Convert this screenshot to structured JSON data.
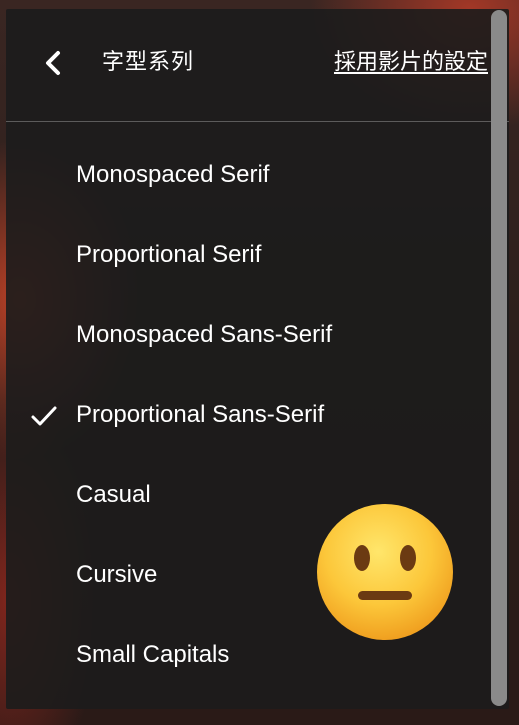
{
  "header": {
    "title": "字型系列",
    "use_video_settings_label": "採用影片的設定",
    "back_icon": "chevron-left-icon"
  },
  "font_family_options": [
    {
      "label": "Monospaced Serif",
      "selected": false
    },
    {
      "label": "Proportional Serif",
      "selected": false
    },
    {
      "label": "Monospaced Sans-Serif",
      "selected": false
    },
    {
      "label": "Proportional Sans-Serif",
      "selected": true
    },
    {
      "label": "Casual",
      "selected": false
    },
    {
      "label": "Cursive",
      "selected": false
    },
    {
      "label": "Small Capitals",
      "selected": false
    }
  ],
  "overlay": {
    "emoji": "neutral-face-emoji"
  },
  "colors": {
    "panel_bg": "#1c1c1c",
    "text": "#ffffff",
    "scrollbar": "#8a8a8a"
  }
}
